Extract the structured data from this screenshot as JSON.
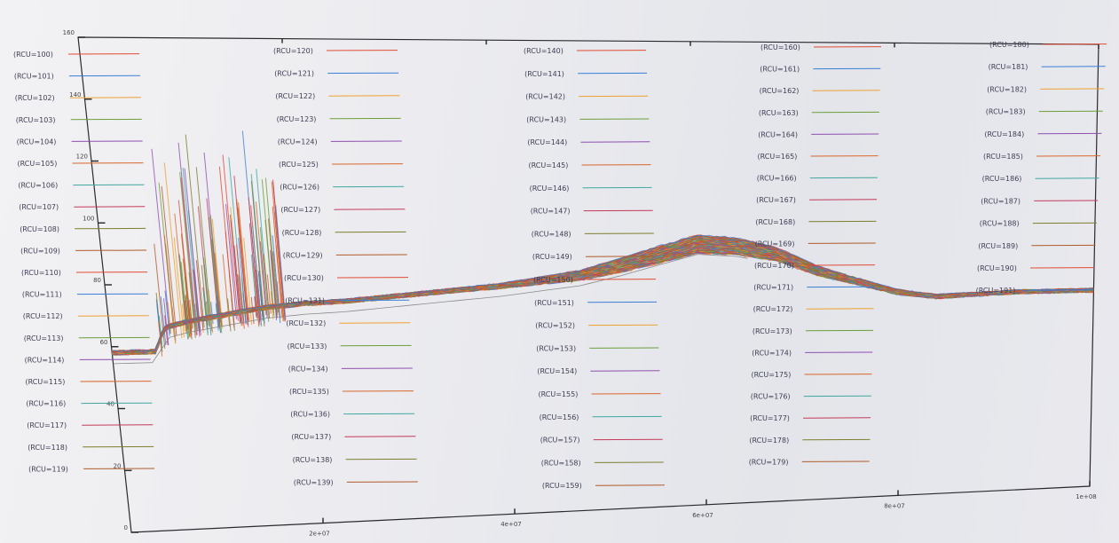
{
  "chart_data": {
    "type": "line",
    "title": "",
    "xlabel": "",
    "ylabel": "",
    "xlim": [
      0,
      100000000.0
    ],
    "ylim": [
      0,
      160
    ],
    "x_ticks": [
      {
        "value": 20000000.0,
        "label": "2e+07"
      },
      {
        "value": 40000000.0,
        "label": "4e+07"
      },
      {
        "value": 60000000.0,
        "label": "6e+07"
      },
      {
        "value": 80000000.0,
        "label": "8e+07"
      },
      {
        "value": 100000000.0,
        "label": "1e+08"
      }
    ],
    "y_ticks": [
      {
        "value": 0,
        "label": "0"
      },
      {
        "value": 20,
        "label": "20"
      },
      {
        "value": 40,
        "label": "40"
      },
      {
        "value": 60,
        "label": "60"
      },
      {
        "value": 80,
        "label": "80"
      },
      {
        "value": 100,
        "label": "100"
      },
      {
        "value": 120,
        "label": "120"
      },
      {
        "value": 140,
        "label": "140"
      },
      {
        "value": 160,
        "label": "160"
      }
    ],
    "grid": false,
    "legend": "inside, five columns",
    "series_count": 92,
    "series_label_format": "(RCU={n})",
    "series_range": [
      100,
      191
    ],
    "legend_columns": [
      {
        "start": 100,
        "end": 119
      },
      {
        "start": 120,
        "end": 139
      },
      {
        "start": 140,
        "end": 159
      },
      {
        "start": 160,
        "end": 179
      },
      {
        "start": 180,
        "end": 191
      }
    ],
    "series_colors": [
      "#e24a33",
      "#3a7fd5",
      "#f0a030",
      "#6a9f3a",
      "#8e4fb0",
      "#d9662a",
      "#3fa7a0",
      "#c43a5a",
      "#7d7d2e",
      "#b05a2a"
    ],
    "typical_profile": {
      "x": [
        0,
        4500000.0,
        5000000.0,
        5500000.0,
        6000000.0,
        8000000.0,
        10000000.0,
        12000000.0,
        14000000.0,
        16000000.0,
        20000000.0,
        24000000.0,
        28000000.0,
        32000000.0,
        36000000.0,
        40000000.0,
        44000000.0,
        48000000.0,
        52000000.0,
        56000000.0,
        60000000.0,
        64000000.0,
        68000000.0,
        72000000.0,
        76000000.0,
        80000000.0,
        84000000.0,
        88000000.0,
        92000000.0,
        96000000.0,
        100000000.0
      ],
      "y": [
        58,
        58,
        62,
        65,
        66,
        67.5,
        68.5,
        69.5,
        70.5,
        71.5,
        72.5,
        73,
        74,
        75,
        76,
        77,
        78.5,
        80,
        83,
        86.5,
        90,
        89,
        86,
        80,
        76,
        72,
        70,
        70.5,
        71,
        71,
        71
      ],
      "spread_at_peak": 5
    },
    "spike_region": {
      "x_start": 5000000.0,
      "x_end": 18000000.0,
      "y_max": 130,
      "note": "dense vertical spikes"
    }
  }
}
